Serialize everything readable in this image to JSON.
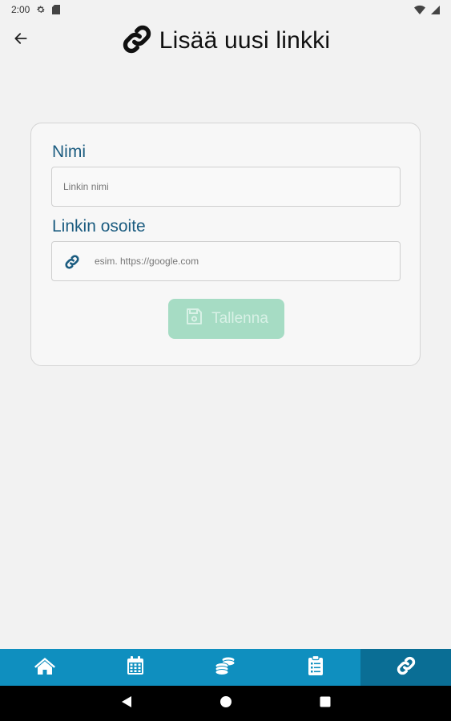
{
  "status_bar": {
    "time": "2:00",
    "icons": [
      "gear-icon",
      "sd-card-icon",
      "wifi-icon",
      "battery-icon"
    ]
  },
  "header": {
    "title": "Lisää uusi linkki",
    "back_icon": "arrow-left-icon",
    "title_icon": "link-icon"
  },
  "form": {
    "name_label": "Nimi",
    "name_placeholder": "Linkin nimi",
    "name_value": "",
    "url_label": "Linkin osoite",
    "url_placeholder": "esim. https://google.com",
    "url_value": "",
    "save_label": "Tallenna",
    "save_enabled": false
  },
  "bottom_nav": {
    "items": [
      {
        "icon": "home-icon",
        "active": false
      },
      {
        "icon": "calendar-icon",
        "active": false
      },
      {
        "icon": "coins-icon",
        "active": false
      },
      {
        "icon": "clipboard-list-icon",
        "active": false
      },
      {
        "icon": "link-icon",
        "active": true
      }
    ]
  },
  "system_nav": {
    "buttons": [
      "back-triangle-icon",
      "home-circle-icon",
      "recents-square-icon"
    ]
  },
  "colors": {
    "background": "#f2f2f2",
    "label": "#1b5c80",
    "nav_bar": "#0f8fbf",
    "nav_active": "#0a6e95",
    "save_button": "#a6dcc4",
    "system_nav": "#000000"
  }
}
